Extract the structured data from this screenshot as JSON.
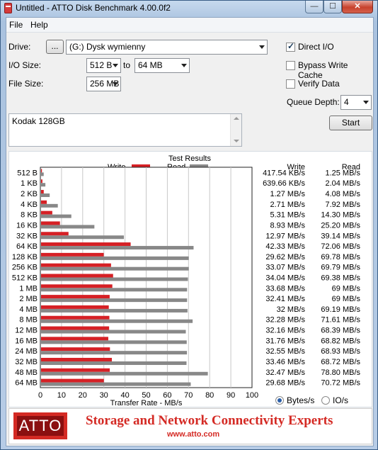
{
  "window": {
    "title": "Untitled - ATTO Disk Benchmark 4.00.0f2",
    "buttons": {
      "minimize": "—",
      "maximize": "☐",
      "close": "✕"
    }
  },
  "menu": {
    "items": [
      "File",
      "Help"
    ]
  },
  "controls": {
    "drive_label": "Drive:",
    "browse_label": "...",
    "drive_value": "(G:) Dysk wymienny",
    "io_size_label": "I/O Size:",
    "io_from": "512 B",
    "to_label": "to",
    "io_to": "64 MB",
    "file_size_label": "File Size:",
    "file_size": "256 MB",
    "direct_io": {
      "label": "Direct I/O",
      "checked": true
    },
    "bypass_cache": {
      "label": "Bypass Write Cache",
      "checked": false
    },
    "verify_data": {
      "label": "Verify Data",
      "checked": false
    },
    "queue_depth_label": "Queue Depth:",
    "queue_depth": "4",
    "start_label": "Start",
    "description": "Kodak 128GB"
  },
  "results": {
    "title": "Test Results",
    "write_col": "Write",
    "read_col": "Read",
    "colors": {
      "write": "#d62025",
      "read": "#888888"
    },
    "units": {
      "bytes": "Bytes/s",
      "io": "IO/s",
      "selected": "bytes"
    }
  },
  "chart_data": {
    "type": "bar",
    "orientation": "horizontal",
    "categories": [
      "512 B",
      "1 KB",
      "2 KB",
      "4 KB",
      "8 KB",
      "16 KB",
      "32 KB",
      "64 KB",
      "128 KB",
      "256 KB",
      "512 KB",
      "1 MB",
      "2 MB",
      "4 MB",
      "8 MB",
      "12 MB",
      "16 MB",
      "24 MB",
      "32 MB",
      "48 MB",
      "64 MB"
    ],
    "series": [
      {
        "name": "Write",
        "values": [
          0.42,
          0.64,
          1.27,
          2.71,
          5.31,
          8.93,
          12.97,
          42.33,
          29.62,
          33.07,
          34.04,
          33.68,
          32.41,
          32,
          32.28,
          32.16,
          31.76,
          32.55,
          33.46,
          32.47,
          29.68
        ]
      },
      {
        "name": "Read",
        "values": [
          1.25,
          2.04,
          4.08,
          7.92,
          14.3,
          25.2,
          39.14,
          72.06,
          69.78,
          69.79,
          69.38,
          69,
          69,
          69.19,
          71.61,
          68.39,
          68.82,
          68.93,
          68.72,
          78.8,
          70.72
        ]
      }
    ],
    "write_text": [
      "417.54 KB/s",
      "639.66 KB/s",
      "1.27 MB/s",
      "2.71 MB/s",
      "5.31 MB/s",
      "8.93 MB/s",
      "12.97 MB/s",
      "42.33 MB/s",
      "29.62 MB/s",
      "33.07 MB/s",
      "34.04 MB/s",
      "33.68 MB/s",
      "32.41 MB/s",
      "32 MB/s",
      "32.28 MB/s",
      "32.16 MB/s",
      "31.76 MB/s",
      "32.55 MB/s",
      "33.46 MB/s",
      "32.47 MB/s",
      "29.68 MB/s"
    ],
    "read_text": [
      "1.25 MB/s",
      "2.04 MB/s",
      "4.08 MB/s",
      "7.92 MB/s",
      "14.30 MB/s",
      "25.20 MB/s",
      "39.14 MB/s",
      "72.06 MB/s",
      "69.78 MB/s",
      "69.79 MB/s",
      "69.38 MB/s",
      "69 MB/s",
      "69 MB/s",
      "69.19 MB/s",
      "71.61 MB/s",
      "68.39 MB/s",
      "68.82 MB/s",
      "68.93 MB/s",
      "68.72 MB/s",
      "78.80 MB/s",
      "70.72 MB/s"
    ],
    "xlabel": "Transfer Rate - MB/s",
    "xticks": [
      0,
      10,
      20,
      30,
      40,
      50,
      60,
      70,
      80,
      90,
      100
    ],
    "xlim": [
      0,
      100
    ],
    "grid": true,
    "legend": "top"
  },
  "banner": {
    "logo": "ATTO",
    "tagline": "Storage and Network Connectivity Experts",
    "url": "www.atto.com"
  }
}
